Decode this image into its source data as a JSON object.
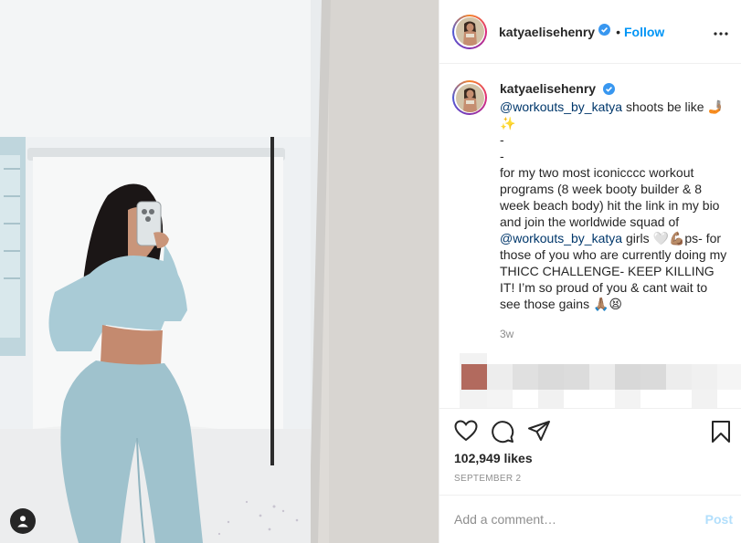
{
  "post": {
    "username": "katyaelisehenry",
    "follow_label": "Follow",
    "separator": "•",
    "caption": {
      "username": "katyaelisehenry",
      "mention_1": "@workouts_by_katya",
      "line_1_after": " shoots be like 🤳🏽✨",
      "dash_1": "-",
      "dash_2": "-",
      "body_1": "for my two most iconicccc workout programs (8 week booty builder & 8 week beach body) hit the link in my bio and join the worldwide squad of ",
      "mention_2": "@workouts_by_katya",
      "body_2": " girls 🤍💪🏽ps- for those of you who are currently doing my THICC CHALLENGE- KEEP KILLING IT! I’m so proud of you & cant wait to see those gains 🙏🏽😫",
      "time_ago": "3w"
    },
    "likes": "102,949 likes",
    "date": "SEPTEMBER 2",
    "comment_placeholder": "Add a comment…",
    "post_button": "Post"
  },
  "icons": {
    "verified": "verified-badge-icon",
    "more": "more-options-icon",
    "like": "heart-icon",
    "comment": "comment-icon",
    "share": "share-icon",
    "save": "bookmark-icon",
    "user_tag": "user-tag-icon"
  },
  "colors": {
    "link_blue": "#0095f6",
    "mention": "#00376b",
    "muted": "#8e8e8e",
    "post_disabled": "#b2dffc",
    "border": "#efefef"
  }
}
